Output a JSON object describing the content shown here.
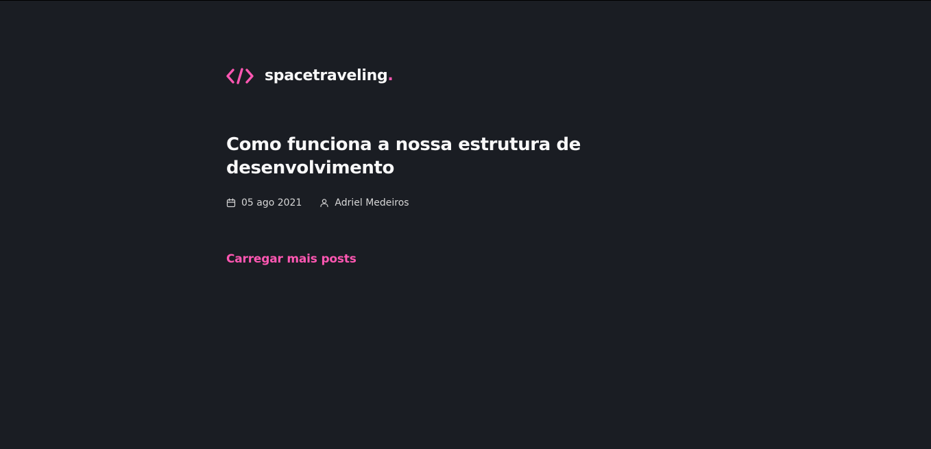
{
  "header": {
    "brand": "spacetraveling",
    "brand_dot": ".",
    "logo_icon": "code-brackets-icon"
  },
  "posts": [
    {
      "title": "Como funciona a nossa estrutura de desenvolvimento",
      "date": "05 ago 2021",
      "author": "Adriel Medeiros",
      "date_icon": "calendar-icon",
      "author_icon": "user-icon"
    }
  ],
  "load_more": {
    "label": "Carregar mais posts"
  },
  "colors": {
    "background": "#1a1d23",
    "accent": "#ff57b2",
    "heading": "#f8f8f8",
    "meta": "#d7d7d7"
  }
}
